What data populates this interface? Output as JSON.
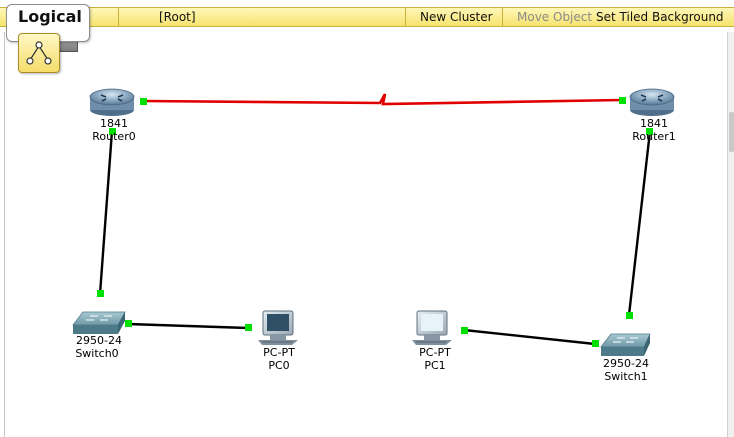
{
  "toolbar": {
    "logical_label": "Logical",
    "root_label": "[Root]",
    "new_cluster_label": "New Cluster",
    "move_object_label": "Move Object",
    "set_tiled_background_label": "Set Tiled Background"
  },
  "devices": {
    "router0": {
      "model": "1841",
      "name": "Router0"
    },
    "router1": {
      "model": "1841",
      "name": "Router1"
    },
    "switch0": {
      "model": "2950-24",
      "name": "Switch0"
    },
    "switch1": {
      "model": "2950-24",
      "name": "Switch1"
    },
    "pc0": {
      "model": "PC-PT",
      "name": "PC0"
    },
    "pc1": {
      "model": "PC-PT",
      "name": "PC1"
    }
  },
  "icons": {
    "logical_icon": "logical-topology-icon",
    "viewport_icon": "viewport-icon",
    "router_icon": "router-icon",
    "switch_icon": "switch-icon",
    "pc_icon": "pc-icon"
  },
  "colors": {
    "serial_link": "#e00000",
    "ethernet_link": "#000000",
    "link_status_up": "#00e000",
    "toolbar_bg": "#f6e36e",
    "disabled_text": "#8a8a8a"
  }
}
